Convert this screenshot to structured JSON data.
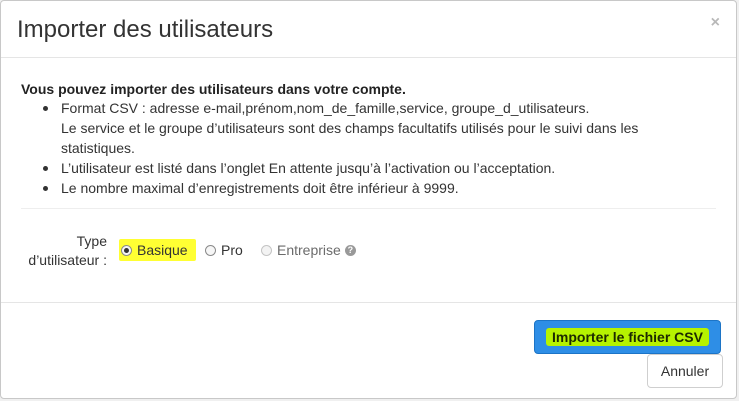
{
  "header": {
    "title": "Importer des utilisateurs",
    "close_symbol": "×"
  },
  "body": {
    "intro": "Vous pouvez importer des utilisateurs dans votre compte.",
    "rules": [
      {
        "line1": "Format CSV : adresse e-mail,prénom,nom_de_famille,service, groupe_d_utilisateurs.",
        "line2": "Le service et le groupe d’utilisateurs sont des champs facultatifs utilisés pour le suivi dans les statistiques."
      },
      {
        "line1": "L’utilisateur est listé dans l’onglet En attente jusqu’à l’activation ou l’acceptation."
      },
      {
        "line1": "Le nombre maximal d’enregistrements doit être inférieur à 9999."
      }
    ],
    "user_type": {
      "label_line1": "Type",
      "label_line2": "d’utilisateur :",
      "options": [
        {
          "label": "Basique",
          "selected": true,
          "disabled": false
        },
        {
          "label": "Pro",
          "selected": false,
          "disabled": false
        },
        {
          "label": "Entreprise",
          "selected": false,
          "disabled": true
        }
      ],
      "help_symbol": "?"
    }
  },
  "footer": {
    "import_label": "Importer le fichier CSV",
    "cancel_label": "Annuler"
  },
  "colors": {
    "primary": "#2e8ee6",
    "highlight_yellow": "#ffff33",
    "highlight_green": "#b6f300"
  },
  "icons": {
    "close": "close-icon",
    "help": "question-circle-icon"
  }
}
